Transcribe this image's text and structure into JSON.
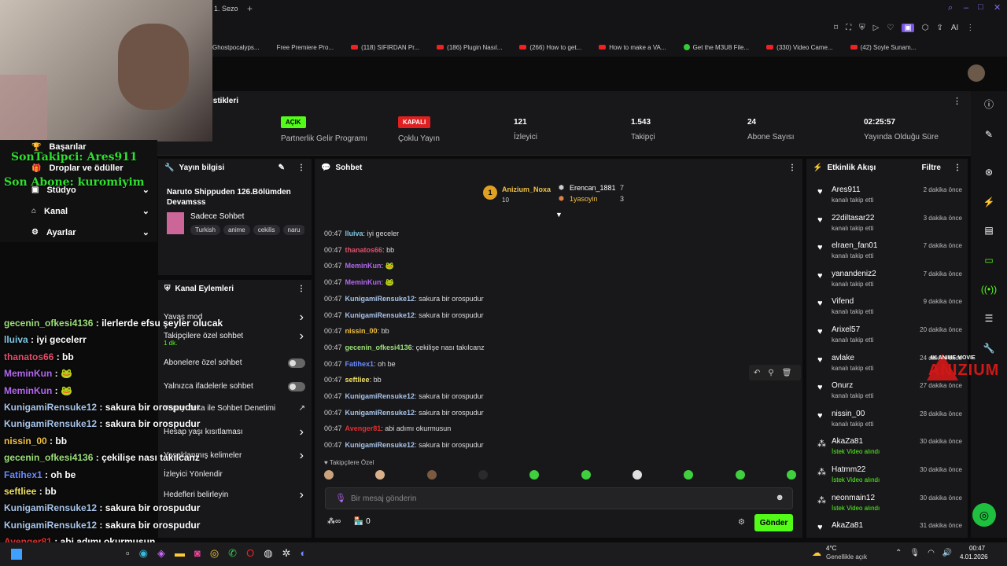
{
  "browser": {
    "tab_label": "1. Sezo"
  },
  "bookmarks": [
    {
      "label": "Ghostpocalyps...",
      "kind": "plain"
    },
    {
      "label": "Free Premiere Pro...",
      "kind": "plain"
    },
    {
      "label": "(118) SIFIRDAN Pr...",
      "kind": "yt"
    },
    {
      "label": "(186) Plugin Nasıl...",
      "kind": "yt"
    },
    {
      "label": "(266) How to get...",
      "kind": "yt"
    },
    {
      "label": "How to make a VA...",
      "kind": "yt"
    },
    {
      "label": "Get the M3U8 File...",
      "kind": "g"
    },
    {
      "label": "(330) Video Came...",
      "kind": "yt"
    },
    {
      "label": "(42) Soyle Sunam...",
      "kind": "yt"
    }
  ],
  "stats": {
    "section_title": "istikleri",
    "items": [
      {
        "value": "",
        "label": "Yayın"
      },
      {
        "badge": "AÇIK",
        "badge_color": "#53fc18",
        "label": "Partnerlik Gelir Programı"
      },
      {
        "badge": "KAPALI",
        "badge_color": "#e02020",
        "label": "Çoklu Yayın"
      },
      {
        "value": "121",
        "label": "İzleyici"
      },
      {
        "value": "1.543",
        "label": "Takipçi"
      },
      {
        "value": "24",
        "label": "Abone Sayısı"
      },
      {
        "value": "02:25:57",
        "label": "Yayında Olduğu Süre"
      }
    ]
  },
  "nav": {
    "items": [
      "Başarılar",
      "Droplar ve ödüller",
      "Stüdyo",
      "Kanal",
      "Ayarlar"
    ]
  },
  "overlay": {
    "son_takipci": "SonTakipci: Ares911",
    "son_abone": "Son Abone: kuromiyim"
  },
  "info": {
    "title": "Yayın bilgisi",
    "stream_title": "Naruto Shippuden 126.Bölümden Devamsss",
    "category": "Sadece Sohbet",
    "tags": [
      "Turkish",
      "anime",
      "cekilis",
      "naru"
    ]
  },
  "actions": {
    "title": "Kanal Eylemleri",
    "items": [
      "Yavaş mod",
      "Takipçilere özel sohbet",
      "Abonelere özel sohbet",
      "Yalnızca ifadelerle sohbet",
      "Yapay Zeka ile Sohbet Denetimi",
      "Hesap yaşı kısıtlaması",
      "Yasaklanmış kelimeler",
      "İzleyici Yönlendir",
      "Hedefleri belirleyin"
    ],
    "sub": "1 dk."
  },
  "chat": {
    "title": "Sohbet",
    "top": [
      {
        "rank": "1",
        "name": "Anizium_Noxa",
        "count": "10"
      },
      {
        "name": "Erencan_1881",
        "count": "7"
      },
      {
        "name": "1yasoyin",
        "count": "3"
      }
    ],
    "messages": [
      {
        "t": "00:47",
        "u": "lluiva",
        "c": "#7ec8e3",
        "m": "iyi geceler"
      },
      {
        "t": "00:47",
        "u": "thanatos66",
        "c": "#e0506a",
        "m": "bb"
      },
      {
        "t": "00:47",
        "u": "MeminKun",
        "c": "#b468f0",
        "m": "🐸"
      },
      {
        "t": "00:47",
        "u": "MeminKun",
        "c": "#b468f0",
        "m": "🐸"
      },
      {
        "t": "00:47",
        "u": "KunigamiRensuke12",
        "c": "#a8c4e8",
        "m": "sakura bir orospudur"
      },
      {
        "t": "00:47",
        "u": "KunigamiRensuke12",
        "c": "#a8c4e8",
        "m": "sakura bir orospudur"
      },
      {
        "t": "00:47",
        "u": "nissin_00",
        "c": "#f0c040",
        "m": "bb"
      },
      {
        "t": "00:47",
        "u": "gecenin_ofkesi4136",
        "c": "#9ee07a",
        "m": "çekilişe nası takılcanz"
      },
      {
        "t": "00:47",
        "u": "Fatihex1",
        "c": "#6a8cff",
        "m": "oh be"
      },
      {
        "t": "00:47",
        "u": "seftliee",
        "c": "#f0e060",
        "m": "bb"
      },
      {
        "t": "00:47",
        "u": "KunigamiRensuke12",
        "c": "#a8c4e8",
        "m": "sakura bir orospudur"
      },
      {
        "t": "00:47",
        "u": "KunigamiRensuke12",
        "c": "#a8c4e8",
        "m": "sakura bir orospudur"
      },
      {
        "t": "00:47",
        "u": "Avenger81",
        "c": "#e03030",
        "m": "abi adımı okurmusun"
      },
      {
        "t": "00:47",
        "u": "KunigamiRensuke12",
        "c": "#a8c4e8",
        "m": "sakura bir orospudur"
      }
    ],
    "follower_label": "Takipçilere Özel",
    "placeholder": "Bir mesaj gönderin",
    "send": "Gönder",
    "footer_count": "0"
  },
  "events": {
    "title": "Etkinlik Akışı",
    "filter": "Filtre",
    "items": [
      {
        "n": "Ares911",
        "s": "kanalı takip etti",
        "d": "2 dakika önce"
      },
      {
        "n": "22diltasar22",
        "s": "kanalı takip etti",
        "d": "3 dakika önce"
      },
      {
        "n": "elraen_fan01",
        "s": "kanalı takip etti",
        "d": "7 dakika önce"
      },
      {
        "n": "yanandeniz2",
        "s": "kanalı takip etti",
        "d": "7 dakika önce"
      },
      {
        "n": "Vifend",
        "s": "kanalı takip etti",
        "d": "9 dakika önce"
      },
      {
        "n": "Arixel57",
        "s": "kanalı takip etti",
        "d": "20 dakika önce"
      },
      {
        "n": "avlake",
        "s": "kanalı takip etti",
        "d": "24 dakika önce"
      },
      {
        "n": "Onurz",
        "s": "kanalı takip etti",
        "d": "27 dakika önce"
      },
      {
        "n": "nissin_00",
        "s": "kanalı takip etti",
        "d": "28 dakika önce"
      },
      {
        "n": "AkaZa81",
        "s": "İstek Video alındı",
        "d": "30 dakika önce"
      },
      {
        "n": "Hatmm22",
        "s": "İstek Video alındı",
        "d": "30 dakika önce"
      },
      {
        "n": "neonmain12",
        "s": "İstek Video alındı",
        "d": "30 dakika önce"
      },
      {
        "n": "AkaZa81",
        "s": "",
        "d": "31 dakika önce"
      }
    ]
  },
  "watermark": {
    "top": "4K ANIME MOVIE",
    "brand": "ANIZIUM"
  },
  "overlay_chat": [
    {
      "u": "gecenin_ofkesi4136",
      "c": "#9ee07a",
      "m": "ilerlerde efsu şeyler olucak"
    },
    {
      "u": "lluiva",
      "c": "#7ec8e3",
      "m": "iyi gecelerr"
    },
    {
      "u": "thanatos66",
      "c": "#e0506a",
      "m": "bb"
    },
    {
      "u": "MeminKun",
      "c": "#b468f0",
      "m": "🐸"
    },
    {
      "u": "MeminKun",
      "c": "#b468f0",
      "m": "🐸"
    },
    {
      "u": "KunigamiRensuke12",
      "c": "#a8c4e8",
      "m": "sakura bir orospudur"
    },
    {
      "u": "KunigamiRensuke12",
      "c": "#a8c4e8",
      "m": "sakura bir orospudur"
    },
    {
      "u": "nissin_00",
      "c": "#f0c040",
      "m": "bb"
    },
    {
      "u": "gecenin_ofkesi4136",
      "c": "#9ee07a",
      "m": "çekilişe nası takılcanz"
    },
    {
      "u": "Fatihex1",
      "c": "#6a8cff",
      "m": "oh be"
    },
    {
      "u": "seftliee",
      "c": "#f0e060",
      "m": "bb"
    },
    {
      "u": "KunigamiRensuke12",
      "c": "#a8c4e8",
      "m": "sakura bir orospudur"
    },
    {
      "u": "KunigamiRensuke12",
      "c": "#a8c4e8",
      "m": "sakura bir orospudur"
    },
    {
      "u": "Avenger81",
      "c": "#e03030",
      "m": "abi adımı okurmusun"
    },
    {
      "u": "KunigamiRensuke12",
      "c": "#a8c4e8",
      "m": "sakura bir orospudur"
    }
  ],
  "taskbar": {
    "weather": "4°C",
    "weather_sub": "Genellikle açık",
    "time": "00:47",
    "date": "4.01.2026",
    "lang": "Ara"
  }
}
